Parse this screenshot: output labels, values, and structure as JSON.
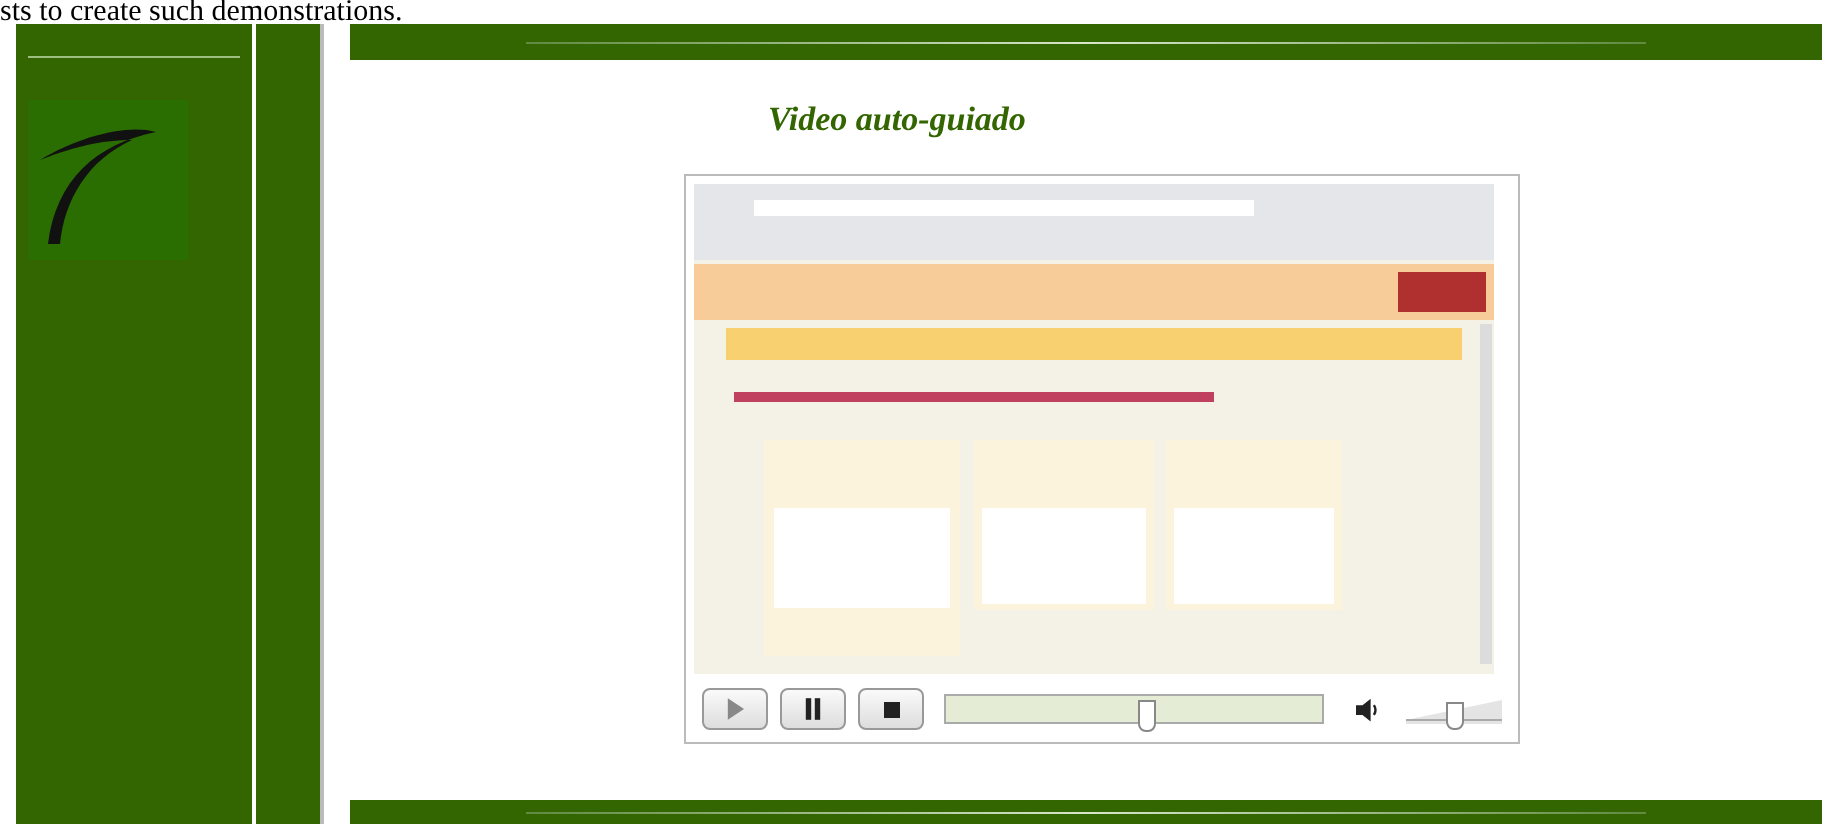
{
  "intro_text": "sts to create such demonstrations.",
  "heading": "Video auto-guiado",
  "video": {
    "kind": "picture",
    "seek": {
      "level": 0.53
    },
    "volume": {
      "level": 0.5
    }
  }
}
